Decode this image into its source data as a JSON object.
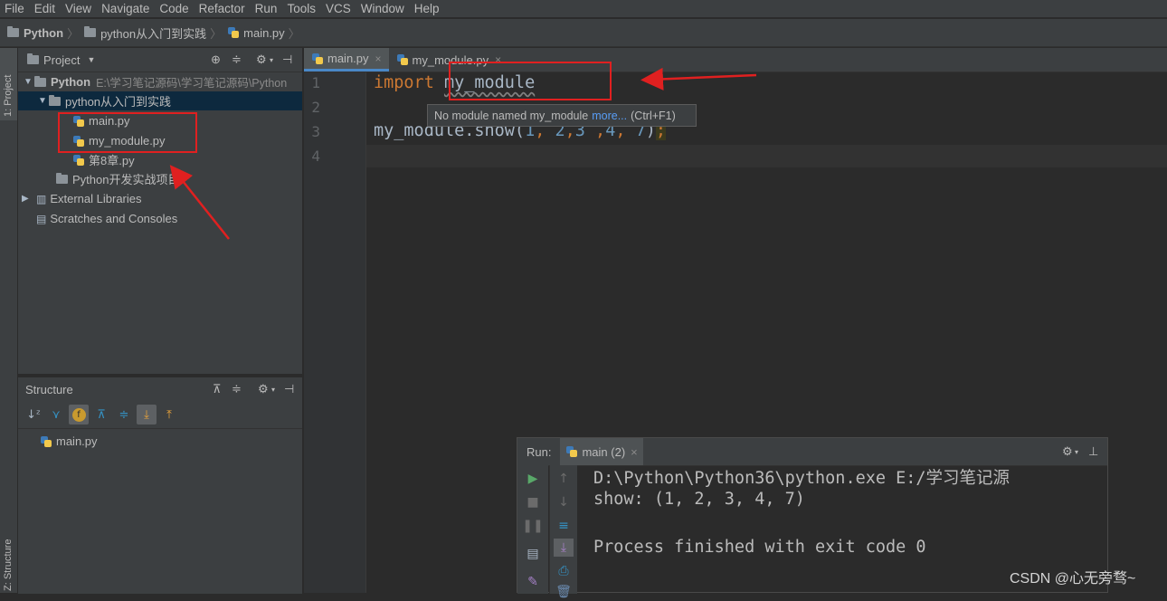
{
  "menu": [
    "File",
    "Edit",
    "View",
    "Navigate",
    "Code",
    "Refactor",
    "Run",
    "Tools",
    "VCS",
    "Window",
    "Help"
  ],
  "breadcrumbs": [
    "Python",
    "python从入门到实践",
    "main.py"
  ],
  "left_stripe": {
    "project_tab": "1: Project",
    "structure_tab": "Z: Structure"
  },
  "project_panel": {
    "title": "Project",
    "dropdown_icon": "chevron-down-icon",
    "tree": {
      "root_label": "Python",
      "root_path": "E:\\学习笔记源码\\学习笔记源码\\Python",
      "folder1": "python从入门到实践",
      "file1": "main.py",
      "file2": "my_module.py",
      "file3": "第8章.py",
      "folder2": "Python开发实战项目",
      "ext_libs": "External Libraries",
      "scratches": "Scratches and Consoles"
    }
  },
  "structure_panel": {
    "title": "Structure",
    "item": "main.py"
  },
  "editor": {
    "tabs": [
      {
        "label": "main.py",
        "active": true
      },
      {
        "label": "my_module.py",
        "active": false
      }
    ],
    "line_numbers": [
      "1",
      "2",
      "3",
      "4"
    ],
    "line1_kw": "import",
    "line1_module": "my_module",
    "line3": {
      "prefix": "my_module.show(",
      "n1": "1",
      "c1": ", ",
      "n2": "2",
      "c2": ",",
      "n3": "3",
      "c3": " ,",
      "n4": "4",
      "c4": ", ",
      "n5": "7",
      "suffix": ")",
      "semi": ";"
    },
    "tooltip": {
      "text": "No module named my_module",
      "link": "more...",
      "shortcut": "(Ctrl+F1)"
    }
  },
  "run_panel": {
    "label": "Run:",
    "tab": "main (2)",
    "console": [
      "D:\\Python\\Python36\\python.exe E:/学习笔记源",
      "show: (1, 2, 3, 4, 7)",
      "",
      "Process finished with exit code 0"
    ]
  },
  "watermark": "CSDN @心无旁骛~",
  "colors": {
    "keyword": "#cc7832",
    "number": "#6897bb",
    "annotation_red": "#e02020",
    "link": "#589df6"
  }
}
